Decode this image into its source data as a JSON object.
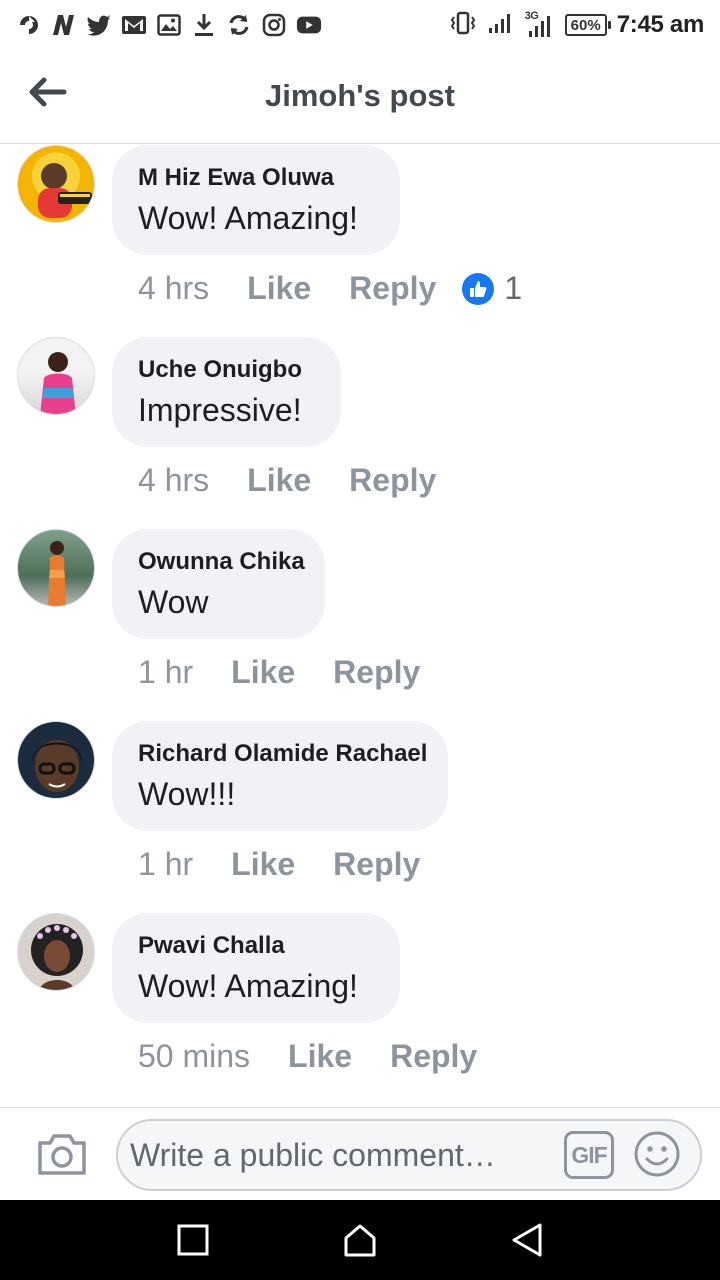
{
  "status_bar": {
    "battery": "60%",
    "time": "7:45 am",
    "network_label": "3G",
    "left_icons": [
      "arrow-app-icon",
      "news-n-icon",
      "twitter-icon",
      "gmail-icon",
      "gallery-icon",
      "download-icon",
      "sync-icon",
      "instagram-icon",
      "youtube-icon"
    ],
    "right_icons": [
      "vibrate-icon",
      "signal-icon",
      "signal-3g-icon",
      "battery-icon"
    ]
  },
  "header": {
    "title": "Jimoh's post"
  },
  "comments": [
    {
      "author": "M Hiz Ewa Oluwa",
      "text": "Wow! Amazing!",
      "time": "4 hrs",
      "like_label": "Like",
      "reply_label": "Reply",
      "reaction_count": "1",
      "avatar_color": "#f5c518"
    },
    {
      "author": "Uche Onuigbo",
      "text": "Impressive!",
      "time": "4 hrs",
      "like_label": "Like",
      "reply_label": "Reply",
      "avatar_color": "#e8408c"
    },
    {
      "author": "Owunna Chika",
      "text": "Wow",
      "time": "1 hr",
      "like_label": "Like",
      "reply_label": "Reply",
      "avatar_color": "#e87b2f"
    },
    {
      "author": "Richard Olamide Rachael",
      "text": "Wow!!!",
      "time": "1 hr",
      "like_label": "Like",
      "reply_label": "Reply",
      "avatar_color": "#2b3f5c"
    },
    {
      "author": "Pwavi Challa",
      "text": "Wow! Amazing!",
      "time": "50 mins",
      "like_label": "Like",
      "reply_label": "Reply",
      "avatar_color": "#6b4a3a"
    }
  ],
  "composer": {
    "placeholder": "Write a public comment…",
    "gif_label": "GIF"
  },
  "colors": {
    "bubble": "#f0f2f5",
    "meta_text": "#8d949e",
    "like_blue": "#1877f2",
    "nav_bar": "#000000"
  }
}
